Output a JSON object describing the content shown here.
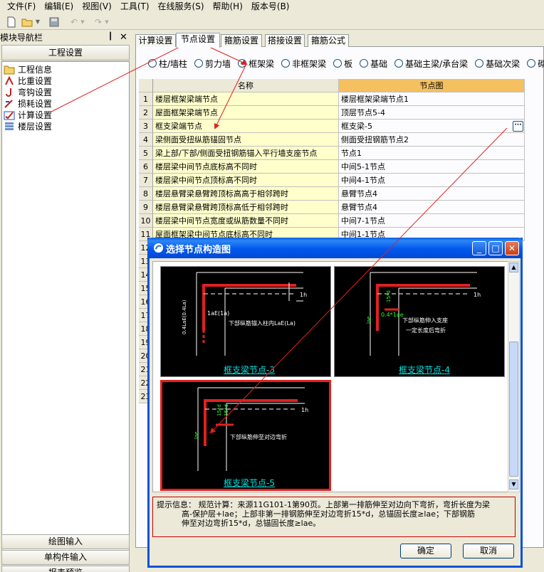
{
  "menu": [
    "文件(F)",
    "编辑(E)",
    "视图(V)",
    "工具(T)",
    "在线服务(S)",
    "帮助(H)",
    "版本号(B)"
  ],
  "sidebar": {
    "title": "模块导航栏",
    "pin": "ᵖ",
    "close": "✕",
    "header": "工程设置",
    "items": [
      "工程信息",
      "比重设置",
      "弯钩设置",
      "损耗设置",
      "计算设置",
      "楼层设置"
    ],
    "bottom": [
      "绘图输入",
      "单构件输入",
      "报表预览"
    ]
  },
  "tabs": [
    "计算设置",
    "节点设置",
    "箍筋设置",
    "搭接设置",
    "箍筋公式"
  ],
  "radios": [
    "柱/墙柱",
    "剪力墙",
    "框架梁",
    "非框架梁",
    "板",
    "基础",
    "基础主梁/承台梁",
    "基础次梁",
    "砌"
  ],
  "grid": {
    "headers": [
      "名称",
      "节点图"
    ],
    "rows": [
      {
        "n": "1",
        "name": "楼层框架梁端节点",
        "value": "楼层框架梁端节点1"
      },
      {
        "n": "2",
        "name": "屋面框架梁端节点",
        "value": "顶层节点5-4"
      },
      {
        "n": "3",
        "name": "框支梁端节点",
        "value": "框支梁-5"
      },
      {
        "n": "4",
        "name": "梁侧面受扭纵筋锚固节点",
        "value": "侧面受扭钢筋节点2"
      },
      {
        "n": "5",
        "name": "梁上部/下部/侧面受扭钢筋锚入平行墙支座节点",
        "value": "节点1"
      },
      {
        "n": "6",
        "name": "楼层梁中间节点底标高不同时",
        "value": "中间5-1节点"
      },
      {
        "n": "7",
        "name": "楼层梁中间节点顶标高不同时",
        "value": "中间4-1节点"
      },
      {
        "n": "8",
        "name": "楼层悬臂梁悬臂跨顶标高高于相邻跨时",
        "value": "悬臂节点4"
      },
      {
        "n": "9",
        "name": "楼层悬臂梁悬臂跨顶标高低于相邻跨时",
        "value": "悬臂节点4"
      },
      {
        "n": "10",
        "name": "楼层梁中间节点宽度或纵筋数量不同时",
        "value": "中间7-1节点"
      },
      {
        "n": "11",
        "name": "屋面框架梁中间节点底标高不同时",
        "value": "中间1-1节点"
      }
    ],
    "more_rows": [
      "12",
      "13",
      "14",
      "15",
      "16",
      "17",
      "18",
      "19",
      "20",
      "21",
      "22",
      "23"
    ],
    "ellipsis": "···"
  },
  "dialog": {
    "title": "选择节点构造图",
    "min": "_",
    "max": "□",
    "close": "✕",
    "thumbs": [
      {
        "label": "框支梁节点-3",
        "text1": "下部纵筋锚入柱内LaE(La)",
        "text2": "1aE(1a)",
        "text3": "1h",
        "text4": "0.4LaE(0.4La)"
      },
      {
        "label": "框支梁节点-4",
        "text1": "下部纵筋伸入支座",
        "text1b": "一定长度后弯折",
        "text2": "15*d",
        "text3": "0.4*1ae",
        "text4": "lae",
        "text5": "1h"
      },
      {
        "label": "框支梁节点-5",
        "text1": "下部纵筋伸至对边弯折",
        "text2": "15*d",
        "text3": "15*d",
        "text4": "lae",
        "text5": "1h"
      }
    ],
    "hint": "提示信息： 规范计算：来源11G101-1第90页。上部第一排筋伸至对边向下弯折，弯折长度为梁\n          高-保护层+lae；上部非第一排钢筋伸至对边弯折15*d，总锚固长度≥lae；下部钢筋\n          伸至对边弯折15*d，总锚固长度≥lae。",
    "ok": "确定",
    "cancel": "取消"
  },
  "colors": {
    "accent_red": "#e02020",
    "selected_radio": "#21a121",
    "header_orange": "#f5c060",
    "row_yellow": "#ffffcc",
    "label_cyan": "#00e0e0"
  }
}
